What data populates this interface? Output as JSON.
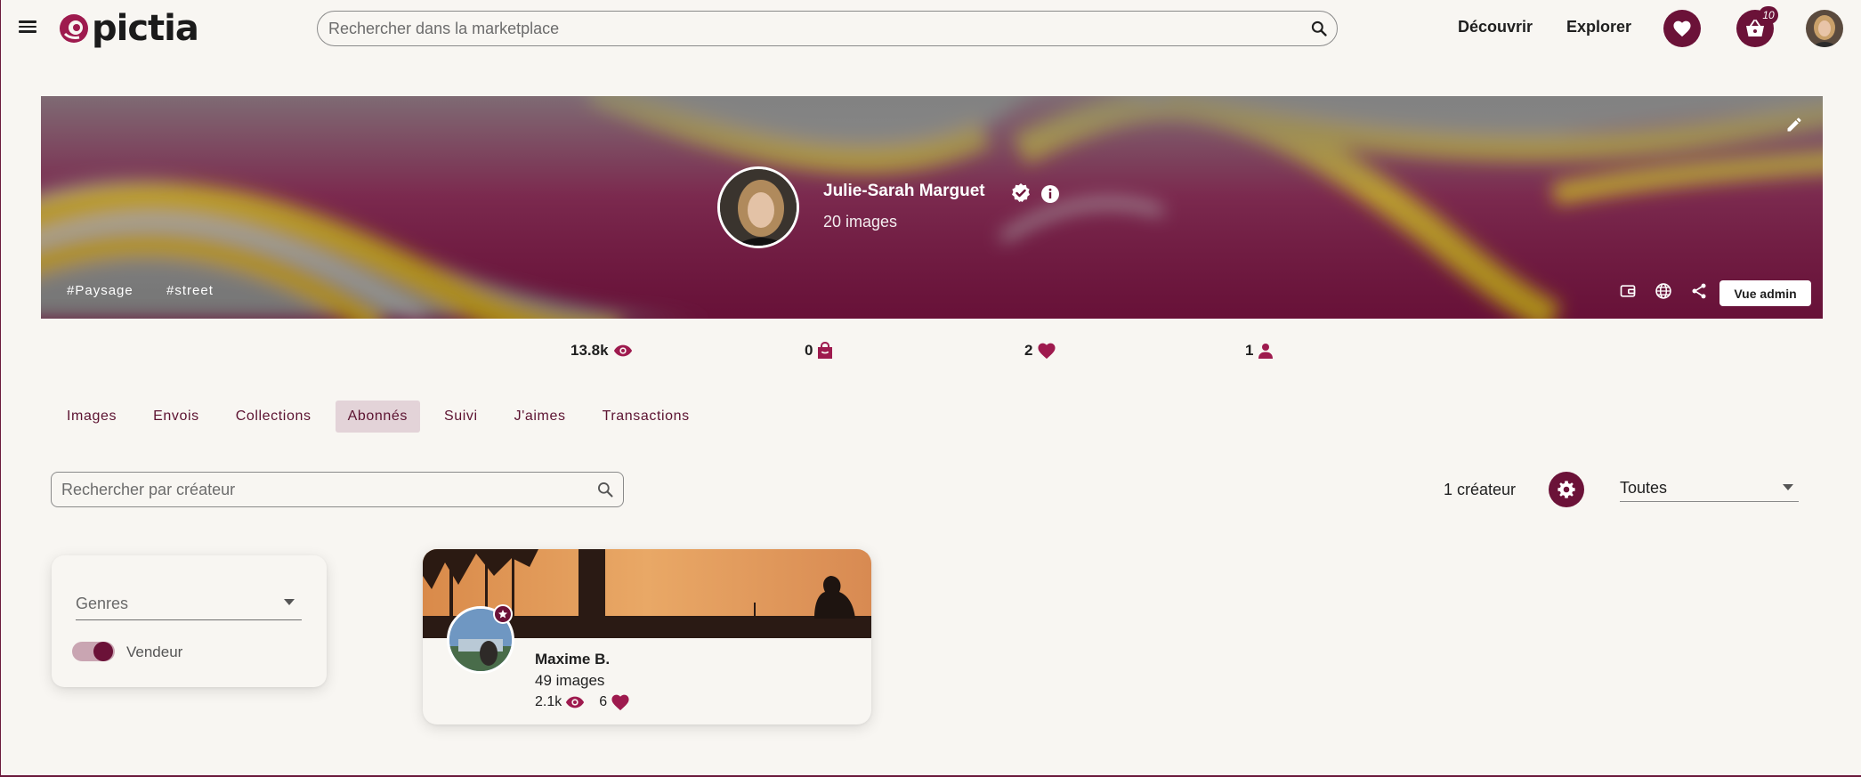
{
  "header": {
    "logo_text": "pictia",
    "search_placeholder": "Rechercher dans la marketplace",
    "nav": {
      "discover": "Découvrir",
      "explore": "Explorer"
    },
    "cart_count": "10",
    "brand_color": "#6b1238"
  },
  "profile": {
    "name": "Julie-Sarah Marguet",
    "images_count": "20 images",
    "tags": [
      "#Paysage",
      "#street"
    ],
    "admin_button": "Vue admin"
  },
  "stats": {
    "views": "13.8k",
    "sales": "0",
    "likes": "2",
    "followers": "1"
  },
  "tabs": [
    {
      "label": "Images",
      "active": false
    },
    {
      "label": "Envois",
      "active": false
    },
    {
      "label": "Collections",
      "active": false
    },
    {
      "label": "Abonnés",
      "active": true
    },
    {
      "label": "Suivi",
      "active": false
    },
    {
      "label": "J'aimes",
      "active": false
    },
    {
      "label": "Transactions",
      "active": false
    }
  ],
  "filters": {
    "creator_search_placeholder": "Rechercher par créateur",
    "creator_count": "1 créateur",
    "select_value": "Toutes",
    "genres_label": "Genres",
    "seller_toggle_label": "Vendeur",
    "seller_toggle_on": true
  },
  "creators": [
    {
      "name": "Maxime B.",
      "images": "49 images",
      "views": "2.1k",
      "likes": "6"
    }
  ]
}
